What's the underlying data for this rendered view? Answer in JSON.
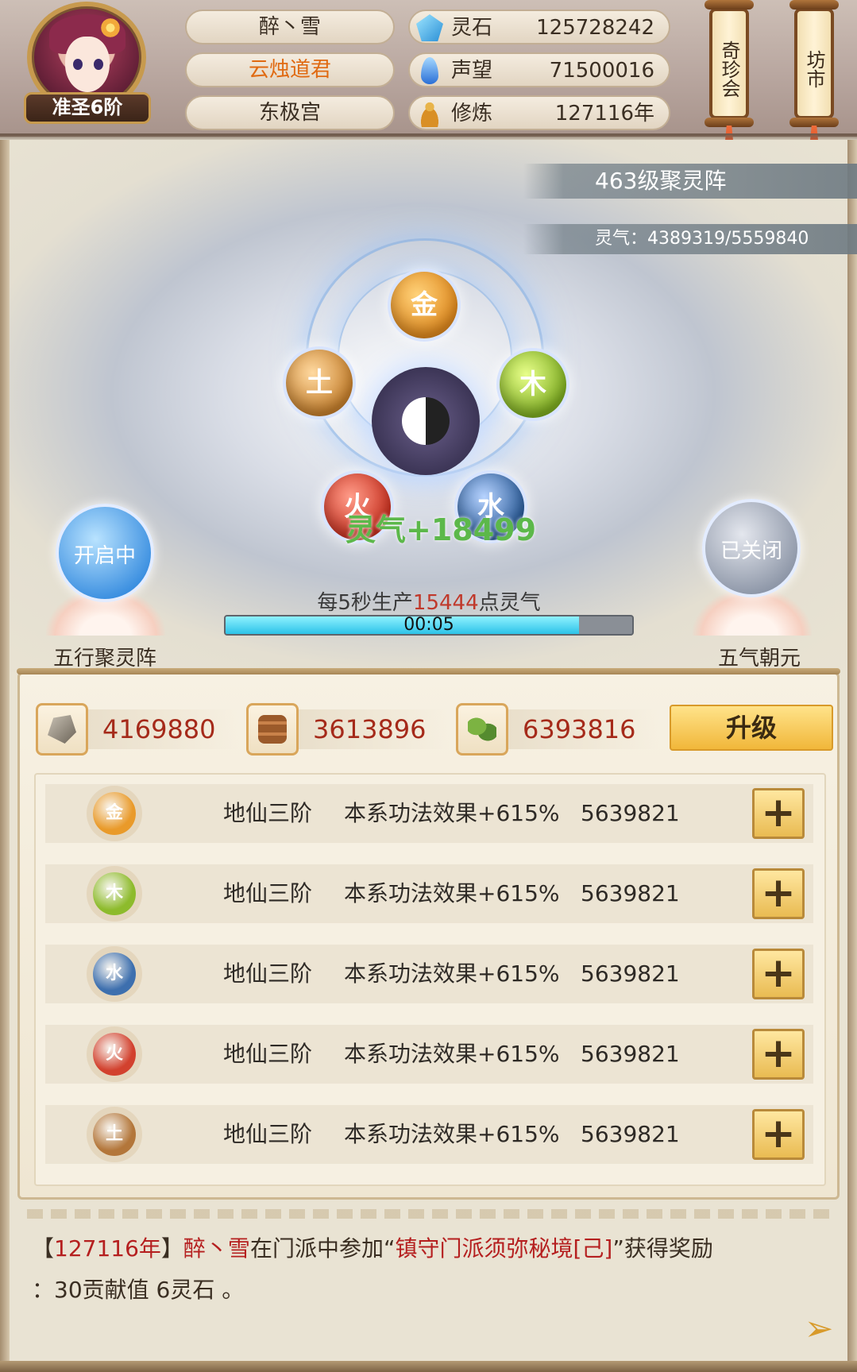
{
  "header": {
    "player_name": "醉丶雪",
    "title": "云烛道君",
    "sect": "东极宫",
    "rank": "准圣6阶",
    "stats": [
      {
        "icon": "spirit-stone-icon",
        "label": "灵石",
        "value": "125728242"
      },
      {
        "icon": "reputation-feather-icon",
        "label": "声望",
        "value": "71500016"
      },
      {
        "icon": "meditation-icon",
        "label": "修炼",
        "value": "127116年"
      }
    ],
    "buttons": {
      "treasure": "奇珍会",
      "market": "坊市"
    }
  },
  "array": {
    "level_title": "463级聚灵阵",
    "qi_text": "灵气：4389319/5559840",
    "elements": {
      "jin": "金",
      "mu": "木",
      "tu": "土",
      "huo": "火",
      "shui": "水"
    },
    "gain_text": "灵气+18499",
    "production": {
      "prefix": "每5秒生产",
      "amount": "15444",
      "suffix": "点灵气"
    },
    "progress": {
      "fraction": 0.87,
      "time": "00:05"
    },
    "left_toggle": {
      "state": "开启中",
      "label": "五行聚灵阵"
    },
    "right_toggle": {
      "state": "已关闭",
      "label": "五气朝元"
    }
  },
  "resources": [
    {
      "icon": "ore-icon",
      "value": "4169880"
    },
    {
      "icon": "wood-icon",
      "value": "3613896"
    },
    {
      "icon": "herb-icon",
      "value": "6393816"
    }
  ],
  "upgrade_label": "升级",
  "element_rows": [
    {
      "element": "金",
      "color": "#e99a2a",
      "level": "地仙三阶",
      "effect": "本系功法效果+615%",
      "value": "5639821"
    },
    {
      "element": "木",
      "color": "#8dbb2c",
      "level": "地仙三阶",
      "effect": "本系功法效果+615%",
      "value": "5639821"
    },
    {
      "element": "水",
      "color": "#3d6fae",
      "level": "地仙三阶",
      "effect": "本系功法效果+615%",
      "value": "5639821"
    },
    {
      "element": "火",
      "color": "#d2412e",
      "level": "地仙三阶",
      "effect": "本系功法效果+615%",
      "value": "5639821"
    },
    {
      "element": "土",
      "color": "#b3763a",
      "level": "地仙三阶",
      "effect": "本系功法效果+615%",
      "value": "5639821"
    }
  ],
  "log": {
    "open_bracket": "【",
    "year": "127116年",
    "close_bracket": "】",
    "player": "醉丶雪",
    "text1": "在门派中参加",
    "quote_open": "“",
    "event": "镇守门派须弥秘境[己]",
    "quote_close": "”",
    "text2": "获得奖励",
    "reward": "：30贡献值 6灵石 。"
  }
}
